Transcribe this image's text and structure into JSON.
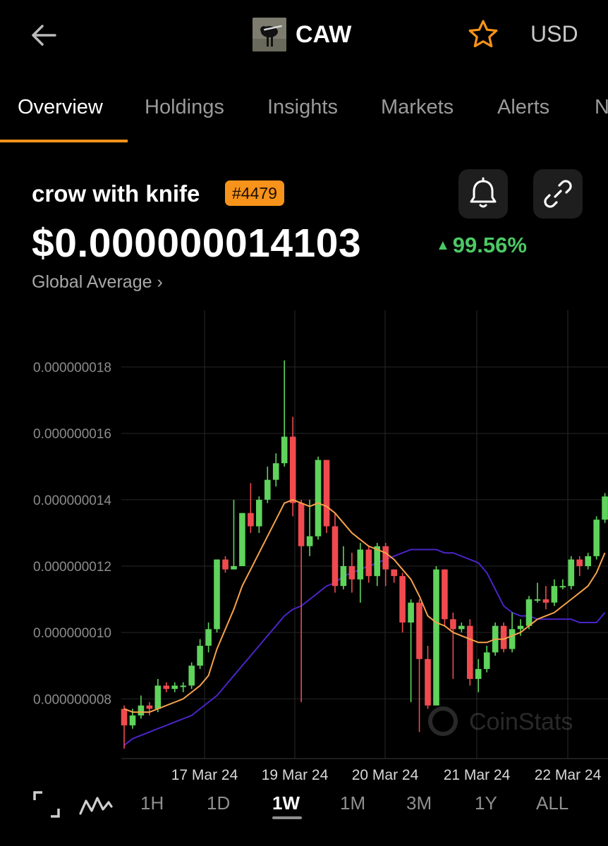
{
  "header": {
    "back_icon": "arrow-left-icon",
    "coin_symbol": "CAW",
    "favorite_icon": "star-icon",
    "favorite_color": "#f7931a",
    "currency": "USD"
  },
  "tabs": [
    {
      "label": "Overview",
      "active": true
    },
    {
      "label": "Holdings"
    },
    {
      "label": "Insights"
    },
    {
      "label": "Markets"
    },
    {
      "label": "Alerts"
    },
    {
      "label": "N"
    }
  ],
  "coin": {
    "name": "crow with knife",
    "rank": "#4479",
    "price": "$0.000000014103",
    "change": "99.56%",
    "change_color": "#4cc965",
    "price_source": "Global Average",
    "alert_icon": "bell-icon",
    "share_icon": "link-icon"
  },
  "chart_data": {
    "type": "candlestick",
    "y_ticks": [
      "0.000000018",
      "0.000000016",
      "0.000000014",
      "0.000000012",
      "0.000000010",
      "0.000000008"
    ],
    "y_tick_values": [
      18,
      16,
      14,
      12,
      10,
      8
    ],
    "y_unit_note": "values in 1e-9 USD",
    "ylim": [
      6.2,
      19.5
    ],
    "x_labels": [
      "17 Mar 24",
      "19 Mar 24",
      "20 Mar 24",
      "21 Mar 24",
      "22 Mar 24"
    ],
    "up_color": "#5fd35b",
    "down_color": "#f04a4f",
    "ma_fast_color": "#f7a24b",
    "ma_slow_color": "#4a24c8",
    "watermark": "CoinStats",
    "candles": [
      [
        7.7,
        7.2,
        7.8,
        6.5
      ],
      [
        7.2,
        7.5,
        7.7,
        7.1
      ],
      [
        7.5,
        7.8,
        8.1,
        7.4
      ],
      [
        7.8,
        7.7,
        7.9,
        7.5
      ],
      [
        7.7,
        8.4,
        8.6,
        7.6
      ],
      [
        8.4,
        8.3,
        8.5,
        8.2
      ],
      [
        8.3,
        8.4,
        8.5,
        8.2
      ],
      [
        8.4,
        8.4,
        8.5,
        8.2
      ],
      [
        8.4,
        9.0,
        9.1,
        8.3
      ],
      [
        9.0,
        9.6,
        9.8,
        8.9
      ],
      [
        9.6,
        10.1,
        10.3,
        9.4
      ],
      [
        10.1,
        12.2,
        12.2,
        10.0
      ],
      [
        12.2,
        11.9,
        12.3,
        11.8
      ],
      [
        11.9,
        12.0,
        14.0,
        11.9
      ],
      [
        12.0,
        13.6,
        13.6,
        12.0
      ],
      [
        13.6,
        13.2,
        14.5,
        13.0
      ],
      [
        13.2,
        14.0,
        14.1,
        13.0
      ],
      [
        14.0,
        14.6,
        15.0,
        13.9
      ],
      [
        14.6,
        15.1,
        15.4,
        14.4
      ],
      [
        15.1,
        15.9,
        18.2,
        15.0
      ],
      [
        15.9,
        13.9,
        16.5,
        13.5
      ],
      [
        13.9,
        12.6,
        14.0,
        7.9
      ],
      [
        12.6,
        12.9,
        14.0,
        12.3
      ],
      [
        12.9,
        15.2,
        15.3,
        12.8
      ],
      [
        15.2,
        13.2,
        15.2,
        13.0
      ],
      [
        13.2,
        11.4,
        13.6,
        11.2
      ],
      [
        11.4,
        12.0,
        12.6,
        11.3
      ],
      [
        12.0,
        11.6,
        12.4,
        11.2
      ],
      [
        11.6,
        12.5,
        12.7,
        10.9
      ],
      [
        12.5,
        11.7,
        12.6,
        11.5
      ],
      [
        11.7,
        12.6,
        12.7,
        11.4
      ],
      [
        12.6,
        11.9,
        12.7,
        11.4
      ],
      [
        11.9,
        11.7,
        11.9,
        11.5
      ],
      [
        11.7,
        10.3,
        11.8,
        10.0
      ],
      [
        10.3,
        10.9,
        11.0,
        7.9
      ],
      [
        10.9,
        9.2,
        11.0,
        7.0
      ],
      [
        9.2,
        7.8,
        9.6,
        7.7
      ],
      [
        7.8,
        11.9,
        12.0,
        7.9
      ],
      [
        11.9,
        10.4,
        11.9,
        10.2
      ],
      [
        10.4,
        10.1,
        10.6,
        8.6
      ],
      [
        10.1,
        10.2,
        10.3,
        10.0
      ],
      [
        10.2,
        8.6,
        10.4,
        8.4
      ],
      [
        8.6,
        8.9,
        9.2,
        8.2
      ],
      [
        8.9,
        9.4,
        9.6,
        8.8
      ],
      [
        9.4,
        10.2,
        10.3,
        9.3
      ],
      [
        10.2,
        9.5,
        10.3,
        9.4
      ],
      [
        9.5,
        10.1,
        10.6,
        9.4
      ],
      [
        10.1,
        10.2,
        10.4,
        9.9
      ],
      [
        10.2,
        11.0,
        11.1,
        10.1
      ],
      [
        11.0,
        11.0,
        11.5,
        10.9
      ],
      [
        11.0,
        10.9,
        11.4,
        10.7
      ],
      [
        10.9,
        11.4,
        11.6,
        10.8
      ],
      [
        11.4,
        11.4,
        11.6,
        11.3
      ],
      [
        11.4,
        12.2,
        12.3,
        11.3
      ],
      [
        12.2,
        12.0,
        12.3,
        11.7
      ],
      [
        12.0,
        12.3,
        12.4,
        11.9
      ],
      [
        12.3,
        13.4,
        13.5,
        12.2
      ],
      [
        13.4,
        14.1,
        14.2,
        13.3
      ]
    ],
    "ma_fast": [
      7.7,
      7.6,
      7.6,
      7.6,
      7.7,
      7.8,
      7.9,
      8.0,
      8.2,
      8.4,
      8.7,
      9.5,
      10.1,
      10.7,
      11.4,
      11.9,
      12.4,
      12.9,
      13.4,
      13.9,
      14.0,
      13.9,
      13.8,
      13.9,
      13.8,
      13.6,
      13.3,
      13.0,
      12.8,
      12.6,
      12.5,
      12.4,
      12.2,
      11.9,
      11.6,
      11.1,
      10.5,
      10.3,
      10.2,
      10.0,
      9.9,
      9.8,
      9.7,
      9.7,
      9.8,
      9.8,
      9.9,
      10.0,
      10.2,
      10.4,
      10.5,
      10.6,
      10.8,
      11.0,
      11.2,
      11.4,
      11.8,
      12.4
    ],
    "ma_slow": [
      6.6,
      6.8,
      6.9,
      7.0,
      7.1,
      7.2,
      7.3,
      7.4,
      7.5,
      7.7,
      7.9,
      8.1,
      8.4,
      8.7,
      9.0,
      9.3,
      9.6,
      9.9,
      10.2,
      10.5,
      10.7,
      10.8,
      11.0,
      11.2,
      11.4,
      11.5,
      11.7,
      11.8,
      11.9,
      12.0,
      12.1,
      12.2,
      12.3,
      12.4,
      12.5,
      12.5,
      12.5,
      12.5,
      12.4,
      12.4,
      12.3,
      12.2,
      12.1,
      11.8,
      11.3,
      10.8,
      10.6,
      10.5,
      10.5,
      10.4,
      10.4,
      10.4,
      10.4,
      10.4,
      10.3,
      10.3,
      10.3,
      10.6
    ]
  },
  "timeframes": {
    "fullscreen_icon": "expand-icon",
    "chart_type_icon": "line-chart-icon",
    "items": [
      "1H",
      "1D",
      "1W",
      "1M",
      "3M",
      "1Y",
      "ALL"
    ],
    "active": "1W"
  }
}
